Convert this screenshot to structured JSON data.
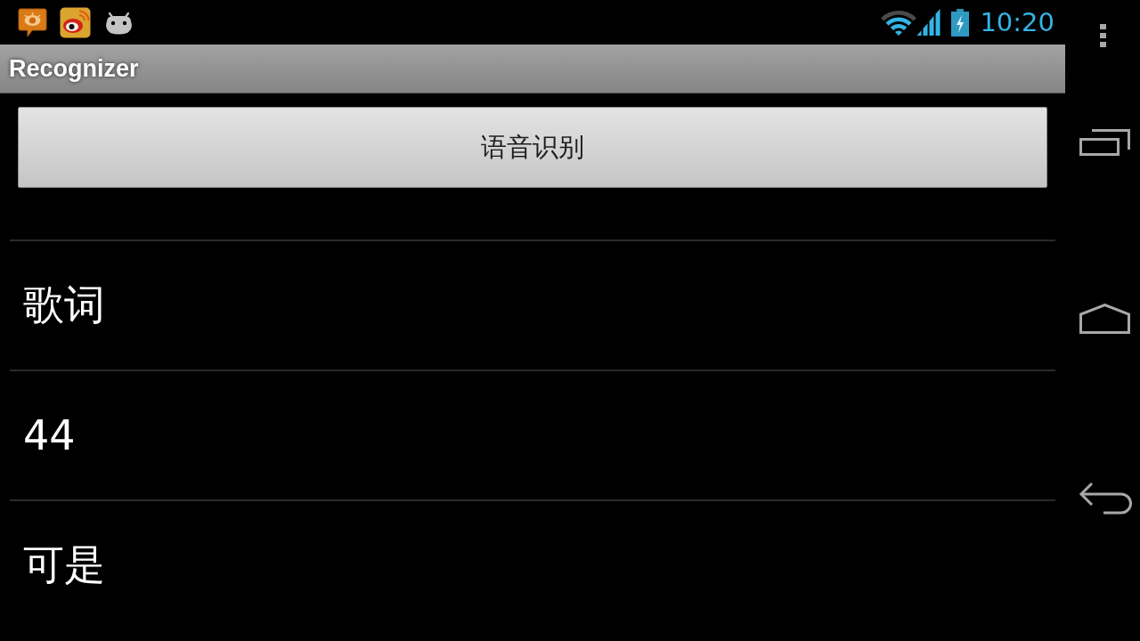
{
  "status_bar": {
    "time": "10:20"
  },
  "action_bar": {
    "title": "Recognizer"
  },
  "recognize_button": {
    "label": "语音识别"
  },
  "results": [
    {
      "text": "歌词"
    },
    {
      "text": "44"
    },
    {
      "text": "可是"
    }
  ]
}
